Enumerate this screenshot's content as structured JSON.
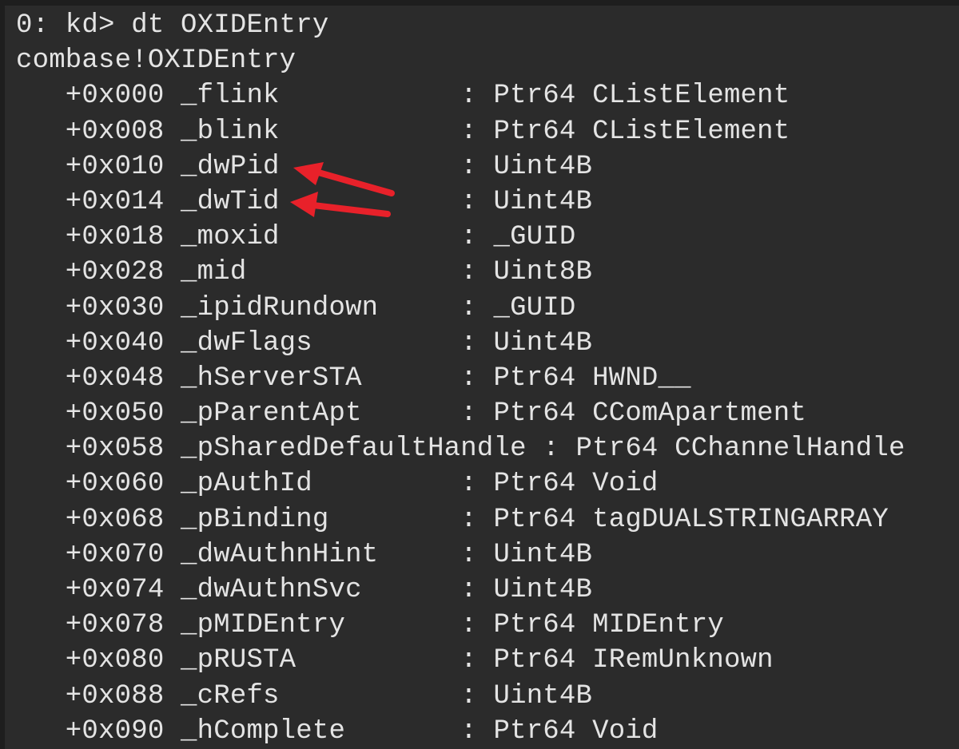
{
  "console": {
    "prompt": "0: kd> dt OXIDEntry",
    "type_name": "combase!OXIDEntry",
    "fields": [
      "   +0x000 _flink           : Ptr64 CListElement",
      "   +0x008 _blink           : Ptr64 CListElement",
      "   +0x010 _dwPid           : Uint4B",
      "   +0x014 _dwTid           : Uint4B",
      "   +0x018 _moxid           : _GUID",
      "   +0x028 _mid             : Uint8B",
      "   +0x030 _ipidRundown     : _GUID",
      "   +0x040 _dwFlags         : Uint4B",
      "   +0x048 _hServerSTA      : Ptr64 HWND__",
      "   +0x050 _pParentApt      : Ptr64 CComApartment",
      "   +0x058 _pSharedDefaultHandle : Ptr64 CChannelHandle",
      "   +0x060 _pAuthId         : Ptr64 Void",
      "   +0x068 _pBinding        : Ptr64 tagDUALSTRINGARRAY",
      "   +0x070 _dwAuthnHint     : Uint4B",
      "   +0x074 _dwAuthnSvc      : Uint4B",
      "   +0x078 _pMIDEntry       : Ptr64 MIDEntry",
      "   +0x080 _pRUSTA          : Ptr64 IRemUnknown",
      "   +0x088 _cRefs           : Uint4B",
      "   +0x090 _hComplete       : Ptr64 Void"
    ]
  },
  "annotation_color": "#e8212a"
}
